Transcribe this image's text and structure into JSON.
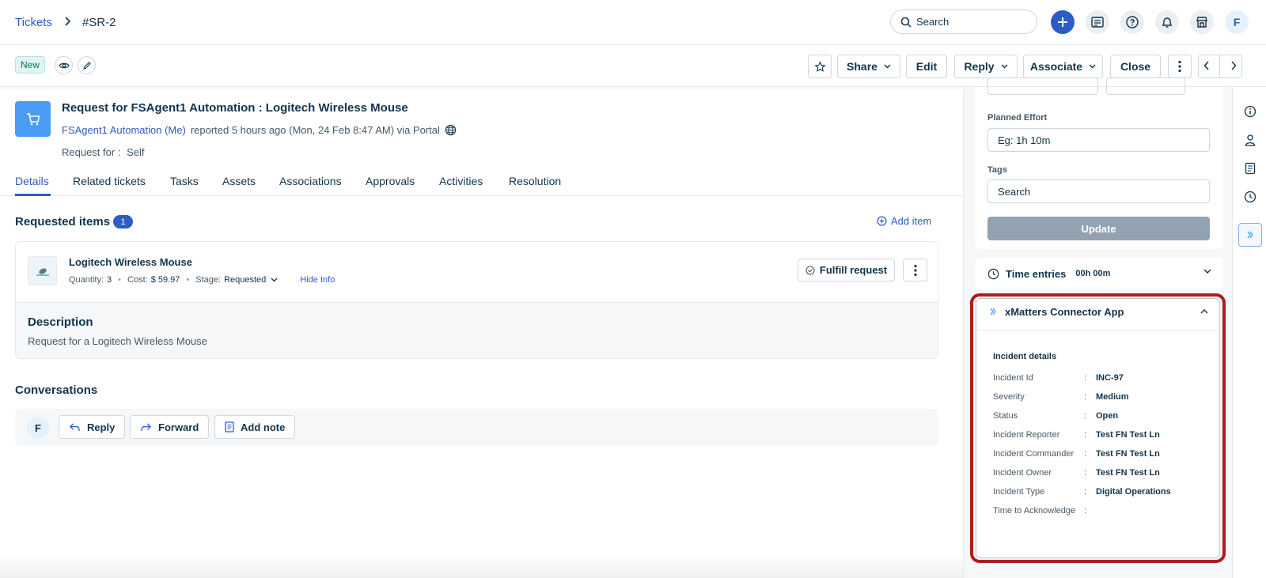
{
  "breadcrumb": {
    "parent": "Tickets",
    "current": "#SR-2"
  },
  "topbar": {
    "search_placeholder": "Search",
    "avatar_initial": "F"
  },
  "actionbar": {
    "status_badge": "New",
    "share_label": "Share",
    "edit_label": "Edit",
    "reply_label": "Reply",
    "associate_label": "Associate",
    "close_label": "Close"
  },
  "ticket": {
    "title": "Request for FSAgent1 Automation : Logitech Wireless Mouse",
    "requester": "FSAgent1 Automation (Me)",
    "reported": "reported 5 hours ago (Mon, 24 Feb 8:47 AM) via Portal",
    "request_for_label": "Request for :",
    "request_for_value": "Self"
  },
  "tabs": [
    "Details",
    "Related tickets",
    "Tasks",
    "Assets",
    "Associations",
    "Approvals",
    "Activities",
    "Resolution"
  ],
  "requested_items": {
    "title": "Requested items",
    "count": "1",
    "add_label": "Add item",
    "item": {
      "name": "Logitech Wireless Mouse",
      "quantity_label": "Quantity:",
      "quantity": "3",
      "cost_label": "Cost:",
      "cost": "$ 59.97",
      "stage_label": "Stage:",
      "stage": "Requested",
      "hide_info": "Hide Info",
      "fulfill_label": "Fulfill request",
      "description_title": "Description",
      "description": "Request for a Logitech Wireless Mouse"
    }
  },
  "conversations": {
    "title": "Conversations",
    "avatar_initial": "F",
    "reply_label": "Reply",
    "forward_label": "Forward",
    "add_note_label": "Add note"
  },
  "properties": {
    "planned_effort_label": "Planned Effort",
    "planned_effort_placeholder": "Eg: 1h 10m",
    "tags_label": "Tags",
    "tags_placeholder": "Search",
    "update_label": "Update",
    "time_entries_label": "Time entries",
    "time_entries_value": "00h 00m"
  },
  "xmatters": {
    "title": "xMatters Connector App",
    "section": "Incident details",
    "rows": [
      {
        "key": "Incident Id",
        "value": "INC-97"
      },
      {
        "key": "Severity",
        "value": "Medium"
      },
      {
        "key": "Status",
        "value": "Open"
      },
      {
        "key": "Incident Reporter",
        "value": "Test FN Test Ln"
      },
      {
        "key": "Incident Commander",
        "value": "Test FN Test Ln"
      },
      {
        "key": "Incident Owner",
        "value": "Test FN Test Ln"
      },
      {
        "key": "Incident Type",
        "value": "Digital Operations"
      },
      {
        "key": "Time to Acknowledge",
        "value": ""
      }
    ]
  },
  "colors": {
    "accent": "#2c5cc5",
    "highlight": "#b01c1c",
    "ticket_icon": "#4a9bf5"
  }
}
